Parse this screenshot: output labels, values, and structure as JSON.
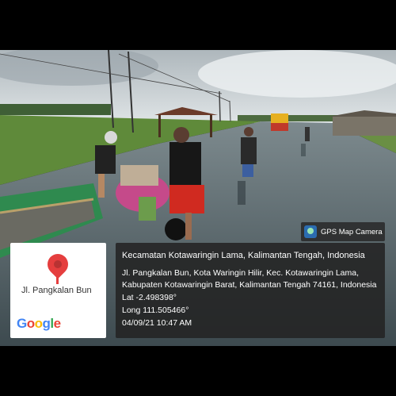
{
  "badge": {
    "icon": "gps-camera-icon",
    "label": "GPS Map Camera"
  },
  "map": {
    "pin_icon": "location-pin-icon",
    "street": "Jl. Pangkalan Bun",
    "logo": "Google"
  },
  "info": {
    "title": "Kecamatan Kotawaringin Lama, Kalimantan Tengah, Indonesia",
    "address_line1": "Jl. Pangkalan Bun, Kota Waringin Hilir, Kec. Kotawaringin Lama,",
    "address_line2": "Kabupaten Kotawaringin Barat, Kalimantan Tengah 74161, Indonesia",
    "lat": "Lat -2.498398°",
    "long": "Long 111.505466°",
    "datetime": "04/09/21 10:47 AM"
  },
  "colors": {
    "info_bg": "#232323",
    "pin": "#e53e3e",
    "water": "#4a5a5f",
    "grass": "#5f8a3a",
    "sky": "#c9d3d8"
  }
}
